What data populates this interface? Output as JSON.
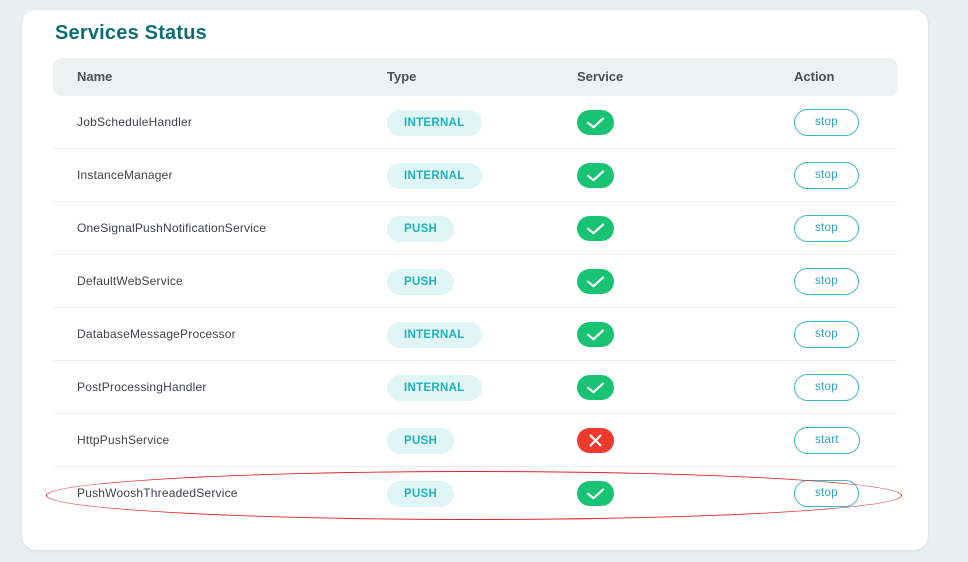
{
  "title": "Services Status",
  "headers": {
    "name": "Name",
    "type": "Type",
    "service": "Service",
    "action": "Action"
  },
  "colors": {
    "accent": "#0f6e73",
    "badge_text": "#1fb2b6",
    "ok": "#18c474",
    "error": "#ee3a2e",
    "highlight": "#e02424"
  },
  "icons": {
    "ok": "check-icon",
    "error": "cross-icon"
  },
  "rows": [
    {
      "name": "JobScheduleHandler",
      "type": "INTERNAL",
      "status": "ok",
      "action": "stop"
    },
    {
      "name": "InstanceManager",
      "type": "INTERNAL",
      "status": "ok",
      "action": "stop"
    },
    {
      "name": "OneSignalPushNotificationService",
      "type": "PUSH",
      "status": "ok",
      "action": "stop"
    },
    {
      "name": "DefaultWebService",
      "type": "PUSH",
      "status": "ok",
      "action": "stop"
    },
    {
      "name": "DatabaseMessageProcessor",
      "type": "INTERNAL",
      "status": "ok",
      "action": "stop"
    },
    {
      "name": "PostProcessingHandler",
      "type": "INTERNAL",
      "status": "ok",
      "action": "stop"
    },
    {
      "name": "HttpPushService",
      "type": "PUSH",
      "status": "error",
      "action": "start"
    },
    {
      "name": "PushWooshThreadedService",
      "type": "PUSH",
      "status": "ok",
      "action": "stop"
    }
  ]
}
